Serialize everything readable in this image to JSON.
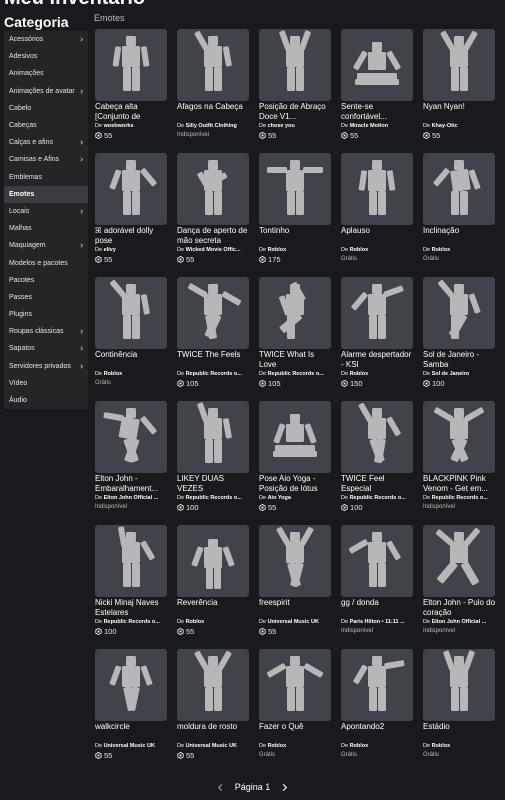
{
  "page_title": "Meu inventário",
  "sidebar": {
    "title": "Categoria",
    "items": [
      {
        "label": "Acessórios",
        "chevron": true
      },
      {
        "label": "Adesivos",
        "chevron": false
      },
      {
        "label": "Animações",
        "chevron": false
      },
      {
        "label": "Animações de avatar",
        "chevron": true
      },
      {
        "label": "Cabelo",
        "chevron": false
      },
      {
        "label": "Cabeças",
        "chevron": false
      },
      {
        "label": "Calças e afins",
        "chevron": true
      },
      {
        "label": "Camisas e Afins",
        "chevron": true
      },
      {
        "label": "Emblemas",
        "chevron": false
      },
      {
        "label": "Emotes",
        "chevron": false,
        "active": true
      },
      {
        "label": "Locais",
        "chevron": true
      },
      {
        "label": "Malhas",
        "chevron": false
      },
      {
        "label": "Maquiagem",
        "chevron": true
      },
      {
        "label": "Modelos e pacotes",
        "chevron": false
      },
      {
        "label": "Pacotes",
        "chevron": false
      },
      {
        "label": "Passes",
        "chevron": false
      },
      {
        "label": "Plugins",
        "chevron": false
      },
      {
        "label": "Roupas clássicas",
        "chevron": true
      },
      {
        "label": "Sapatos",
        "chevron": true
      },
      {
        "label": "Servidores privados",
        "chevron": true
      },
      {
        "label": "Vídeo",
        "chevron": false
      },
      {
        "label": "Áudio",
        "chevron": false
      }
    ]
  },
  "section_label": "Emotes",
  "creator_prefix": "De",
  "items": [
    {
      "name": "Cabeça alta [Conjunto de",
      "creator": "woebworks",
      "price": "55",
      "pose": "stand"
    },
    {
      "name": "Afagos na Cabeça",
      "creator": "Silly Outfit Clothing",
      "price": "Indisponível",
      "pose": "headpat"
    },
    {
      "name": "Posição de Abraço Doce V1...",
      "creator": "chose you",
      "price": "55",
      "pose": "hug"
    },
    {
      "name": "Sente-se confortável...",
      "creator": "Miracle Motion",
      "price": "55",
      "pose": "sit"
    },
    {
      "name": "Nyan Nyan!",
      "creator": "Khay-Otic",
      "price": "55",
      "pose": "nyan"
    },
    {
      "name": "ꕤ adorável dolly pose",
      "creator": "elivy",
      "price": "55",
      "pose": "dolly"
    },
    {
      "name": "Dança de aperto de mão secreta",
      "creator": "Wicked Movie Offic...",
      "price": "55",
      "pose": "handshake"
    },
    {
      "name": "Tontinho",
      "creator": "Roblox",
      "price": "175",
      "pose": "tpose"
    },
    {
      "name": "Aplauso",
      "creator": "Roblox",
      "price": "Grátis",
      "pose": "stand"
    },
    {
      "name": "Inclinação",
      "creator": "Roblox",
      "price": "Grátis",
      "pose": "lean"
    },
    {
      "name": "Continência",
      "creator": "Roblox",
      "price": "Grátis",
      "pose": "salute"
    },
    {
      "name": "TWICE The Feels",
      "creator": "Republic Records o...",
      "price": "105",
      "pose": "feels"
    },
    {
      "name": "TWICE What Is Love",
      "creator": "Republic Records o...",
      "price": "105",
      "pose": "love"
    },
    {
      "name": "Alarme despertador - KSI",
      "creator": "Roblox",
      "price": "150",
      "pose": "alarm"
    },
    {
      "name": "Sol de Janeiro - Samba",
      "creator": "Sol de Janeiro",
      "price": "100",
      "pose": "samba"
    },
    {
      "name": "Elton John - Embaralhament...",
      "creator": "Elton John Official ...",
      "price": "Indisponível",
      "pose": "shuffle"
    },
    {
      "name": "LIKEY DUAS VEZES",
      "creator": "Republic Records o...",
      "price": "100",
      "pose": "likey"
    },
    {
      "name": "Pose Aio Yoga - Posição de lótus",
      "creator": "Aio Yoga",
      "price": "55",
      "pose": "lotus"
    },
    {
      "name": "TWICE Feel Especial",
      "creator": "Republic Records o...",
      "price": "100",
      "pose": "special"
    },
    {
      "name": "BLACKPINK Pink Venom - Get em...",
      "creator": "Republic Records o...",
      "price": "Indisponível",
      "pose": "venom"
    },
    {
      "name": "Nicki Minaj Naves Estelares",
      "creator": "Republic Records o...",
      "price": "100",
      "pose": "starships"
    },
    {
      "name": "Reverência",
      "creator": "Roblox",
      "price": "55",
      "pose": "bow"
    },
    {
      "name": "freespirit",
      "creator": "Universal Music UK",
      "price": "55",
      "pose": "spirit"
    },
    {
      "name": "gg / donda",
      "creator": "Paris Hilton • 11:11 ...",
      "price": "Indisponível",
      "pose": "donda"
    },
    {
      "name": "Elton John - Pulo do coração",
      "creator": "Elton John Official ...",
      "price": "Indisponível",
      "pose": "jump"
    },
    {
      "name": "walkcircle",
      "creator": "Universal Music UK",
      "price": "55",
      "pose": "walk"
    },
    {
      "name": "moldura de rosto",
      "creator": "Universal Music UK",
      "price": "55",
      "pose": "frame"
    },
    {
      "name": "Fazer o Quê",
      "creator": "Roblox",
      "price": "Grátis",
      "pose": "shrug"
    },
    {
      "name": "Apontando2",
      "creator": "Roblox",
      "price": "Grátis",
      "pose": "point"
    },
    {
      "name": "Estádio",
      "creator": "Roblox",
      "price": "Grátis",
      "pose": "stadium"
    }
  ],
  "pagination": {
    "label": "Página 1"
  },
  "colors": {
    "background": "#191a1d",
    "sidebar": "#232527",
    "sidebar_active": "#3a3c40",
    "thumb": "#41434a",
    "figure": "#b7b7b9"
  },
  "icons": {
    "robux": "robux-icon",
    "chevron": "chevron-right-icon"
  }
}
